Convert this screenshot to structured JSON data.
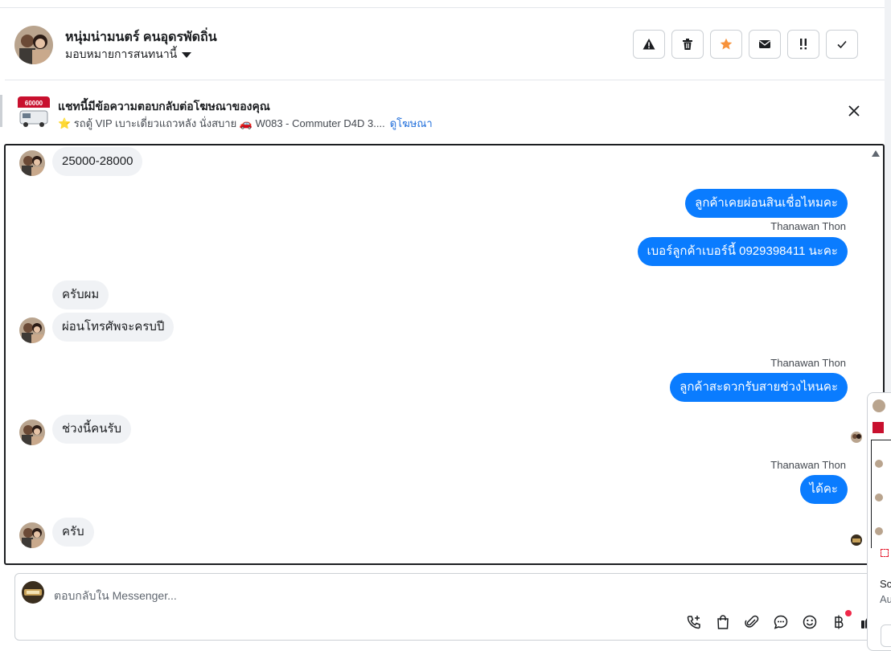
{
  "header": {
    "contact_name": "หนุ่มน่ามนตร์ คนอุดรพัดถิ่น",
    "assign_label": "มอบหมายการสนทนานี้",
    "actions": [
      {
        "name": "report-spam-button",
        "icon": "warning-icon"
      },
      {
        "name": "delete-button",
        "icon": "trash-icon"
      },
      {
        "name": "star-button",
        "icon": "star-icon"
      },
      {
        "name": "mark-unread-button",
        "icon": "envelope-icon"
      },
      {
        "name": "follow-up-button",
        "icon": "exclamation-icon"
      },
      {
        "name": "mark-done-button",
        "icon": "check-icon"
      }
    ]
  },
  "ad": {
    "title": "แชทนี้มีข้อความตอบกลับต่อโฆษณาของคุณ",
    "description": "⭐ รถตู้ VIP เบาะเดี่ยวแถวหลัง นั่งสบาย 🚗 W083 - Commuter D4D 3....",
    "link": "ดูโฆษณา",
    "thumb_text": "60000"
  },
  "messages": [
    {
      "dir": "in",
      "text": "25000-28000"
    },
    {
      "dir": "out",
      "text": "ลูกค้าเคยผ่อนสินเชื่อไหมคะ"
    },
    {
      "sender": "Thanawan Thon"
    },
    {
      "dir": "out",
      "text": "เบอร์ลูกค้าเบอร์นี้ 0929398411 นะคะ"
    },
    {
      "dir": "in",
      "text": "ครับผม"
    },
    {
      "dir": "in",
      "text": "ผ่อนโทรศัพจะครบปี"
    },
    {
      "sender": "Thanawan Thon"
    },
    {
      "dir": "out",
      "text": "ลูกค้าสะดวกรับสายช่วงไหนคะ"
    },
    {
      "dir": "in",
      "text": "ช่วงนี้คนรับ"
    },
    {
      "sender": "Thanawan Thon"
    },
    {
      "dir": "out",
      "text": "ได้คะ"
    },
    {
      "dir": "in",
      "text": "ครับ"
    }
  ],
  "composer": {
    "placeholder": "ตอบกลับใน Messenger..."
  },
  "mini_panel": {
    "line1": "Sc",
    "line2": "Au"
  },
  "colors": {
    "outgoing": "#0a7cff",
    "incoming": "#f0f2f5",
    "star": "#f7923b",
    "notification_dot": "#f02849",
    "link": "#216fdb"
  }
}
